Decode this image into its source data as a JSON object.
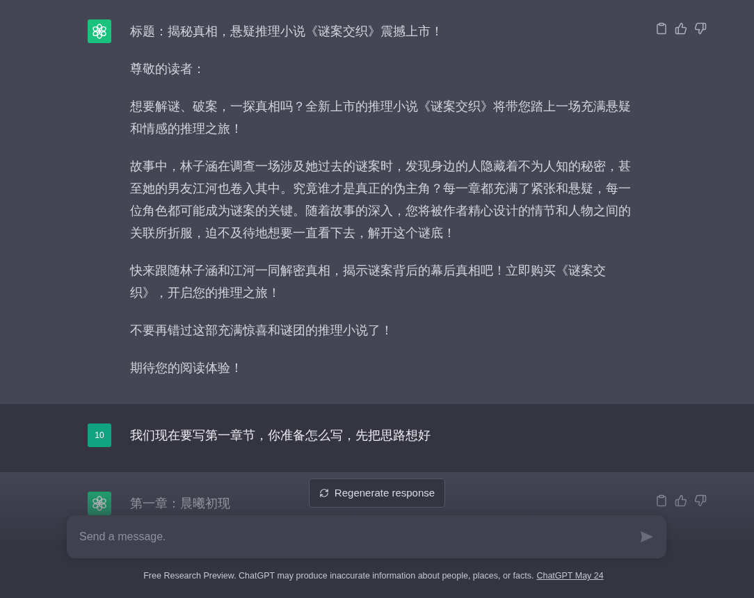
{
  "messages": [
    {
      "kind": "assistant",
      "paragraphs": [
        "标题：揭秘真相，悬疑推理小说《谜案交织》震撼上市！",
        "尊敬的读者：",
        "想要解谜、破案，一探真相吗？全新上市的推理小说《谜案交织》将带您踏上一场充满悬疑和情感的推理之旅！",
        "故事中，林子涵在调查一场涉及她过去的谜案时，发现身边的人隐藏着不为人知的秘密，甚至她的男友江河也卷入其中。究竟谁才是真正的伪主角？每一章都充满了紧张和悬疑，每一位角色都可能成为谜案的关键。随着故事的深入，您将被作者精心设计的情节和人物之间的关联所折服，迫不及待地想要一直看下去，解开这个谜底！",
        "快来跟随林子涵和江河一同解密真相，揭示谜案背后的幕后真相吧！立即购买《谜案交织》，开启您的推理之旅！",
        "不要再错过这部充满惊喜和谜团的推理小说了！",
        "期待您的阅读体验！"
      ]
    },
    {
      "kind": "user",
      "avatar_text": "10",
      "paragraphs": [
        "我们现在要写第一章节，你准备怎么写，先把思路想好"
      ]
    },
    {
      "kind": "assistant",
      "paragraphs": [
        "第一章：晨曦初现"
      ]
    }
  ],
  "regenerate_button": "Regenerate response",
  "input": {
    "placeholder": "Send a message."
  },
  "footer": {
    "text": "Free Research Preview. ChatGPT may produce inaccurate information about people, places, or facts.",
    "link": "ChatGPT May 24"
  }
}
